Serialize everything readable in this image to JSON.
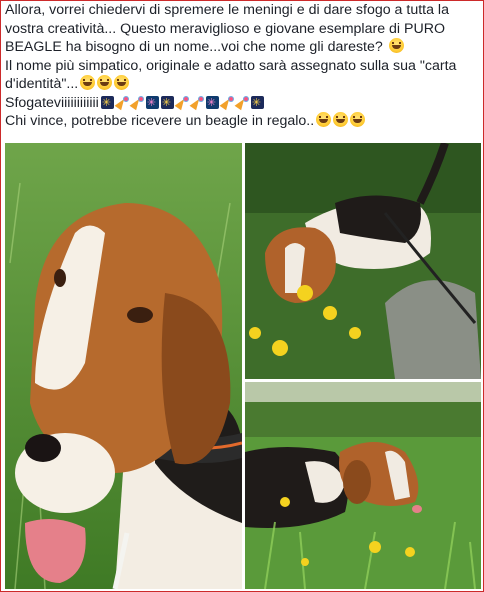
{
  "post": {
    "lines": [
      "Allora, vorrei chiedervi di spremere le meningi e di dare sfogo a tutta la",
      "vostra creatività... Questo meraviglioso e giovane esemplare di PURO",
      "BEAGLE ha bisogno di un nome...voi che nome gli dareste?",
      "Il nome più simpatico, originale e adatto sarà assegnato sulla sua \"carta",
      "d'identità\"...",
      "Sfogateviiiiiiiiiiii",
      "Chi vince, potrebbe ricevere un beagle in regalo.."
    ],
    "emoji": {
      "laughing": "laughing-face",
      "fireworks": "fireworks",
      "party_popper": "party-popper"
    }
  },
  "photos": [
    {
      "name": "beagle-closeup-photo",
      "subject": "beagle portrait with tongue out"
    },
    {
      "name": "beagle-sniffing-flowers-photo",
      "subject": "beagle on leash among yellow flowers"
    },
    {
      "name": "beagle-in-grass-photo",
      "subject": "beagle eating grass"
    }
  ],
  "colors": {
    "frame_border": "#cc2a2a",
    "text": "#1d2129",
    "grass": "#4f8a2e",
    "fur_brown": "#9a5a26"
  }
}
